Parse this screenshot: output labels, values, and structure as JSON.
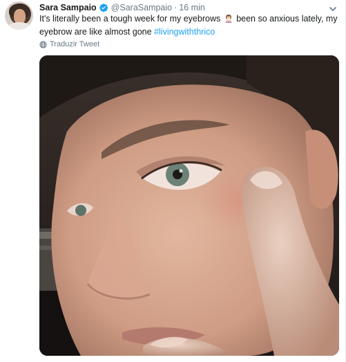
{
  "tweet": {
    "author_name": "Sara Sampaio",
    "handle": "@SaraSampaio",
    "separator": "·",
    "time": "16 min",
    "text_before_emoji": "It's literally been a tough week for my eyebrows ",
    "text_after_emoji": " been so anxious lately, my eyebrow are like almost gone ",
    "hashtag": "#livingwiththrico",
    "translate_label": "Traduzir Tweet",
    "icons": {
      "verified": "verified-badge-icon",
      "caret": "chevron-down-icon",
      "emoji": "woman-gesturing-no-emoji-icon",
      "translate": "globe-icon"
    }
  },
  "colors": {
    "link": "#1da1f2",
    "text": "#14171a",
    "muted": "#657786"
  }
}
